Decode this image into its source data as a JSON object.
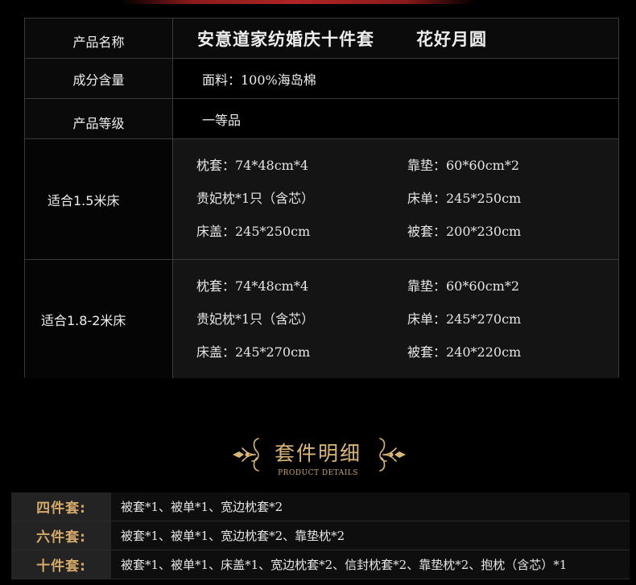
{
  "colors": {
    "accent_gold": "#d9b676",
    "label_gold": "#d4aa6a",
    "background": "#000000",
    "top_accent_red": "#b02525"
  },
  "spec": {
    "product_name": {
      "label": "产品名称",
      "name": "安意道家纺婚庆十件套",
      "series": "花好月圆"
    },
    "composition": {
      "label": "成分含量",
      "value": "面料：100%海岛棉"
    },
    "grade": {
      "label": "产品等级",
      "value": "一等品"
    },
    "size_15": {
      "label": "适合1.5米床",
      "items": [
        "枕套：74*48cm*4",
        "靠垫：60*60cm*2",
        "贵妃枕*1只（含芯）",
        "床单：245*250cm",
        "床盖：245*250cm",
        "被套：200*230cm"
      ]
    },
    "size_18": {
      "label": "适合1.8-2米床",
      "items": [
        "枕套：74*48cm*4",
        "靠垫：60*60cm*2",
        "贵妃枕*1只（含芯）",
        "床单：245*270cm",
        "床盖：245*270cm",
        "被套：240*220cm"
      ]
    }
  },
  "section": {
    "title": "套件明细",
    "subtitle": "PRODUCT DETAILS",
    "ornament_icon": "fleur-scroll-icon"
  },
  "packages": [
    {
      "label": "四件套:",
      "contents": "被套*1、被单*1、宽边枕套*2"
    },
    {
      "label": "六件套:",
      "contents": "被套*1、被单*1、宽边枕套*2、靠垫枕*2"
    },
    {
      "label": "十件套:",
      "contents": "被套*1、被单*1、床盖*1、宽边枕套*2、信封枕套*2、靠垫枕*2、抱枕（含芯）*1"
    }
  ]
}
